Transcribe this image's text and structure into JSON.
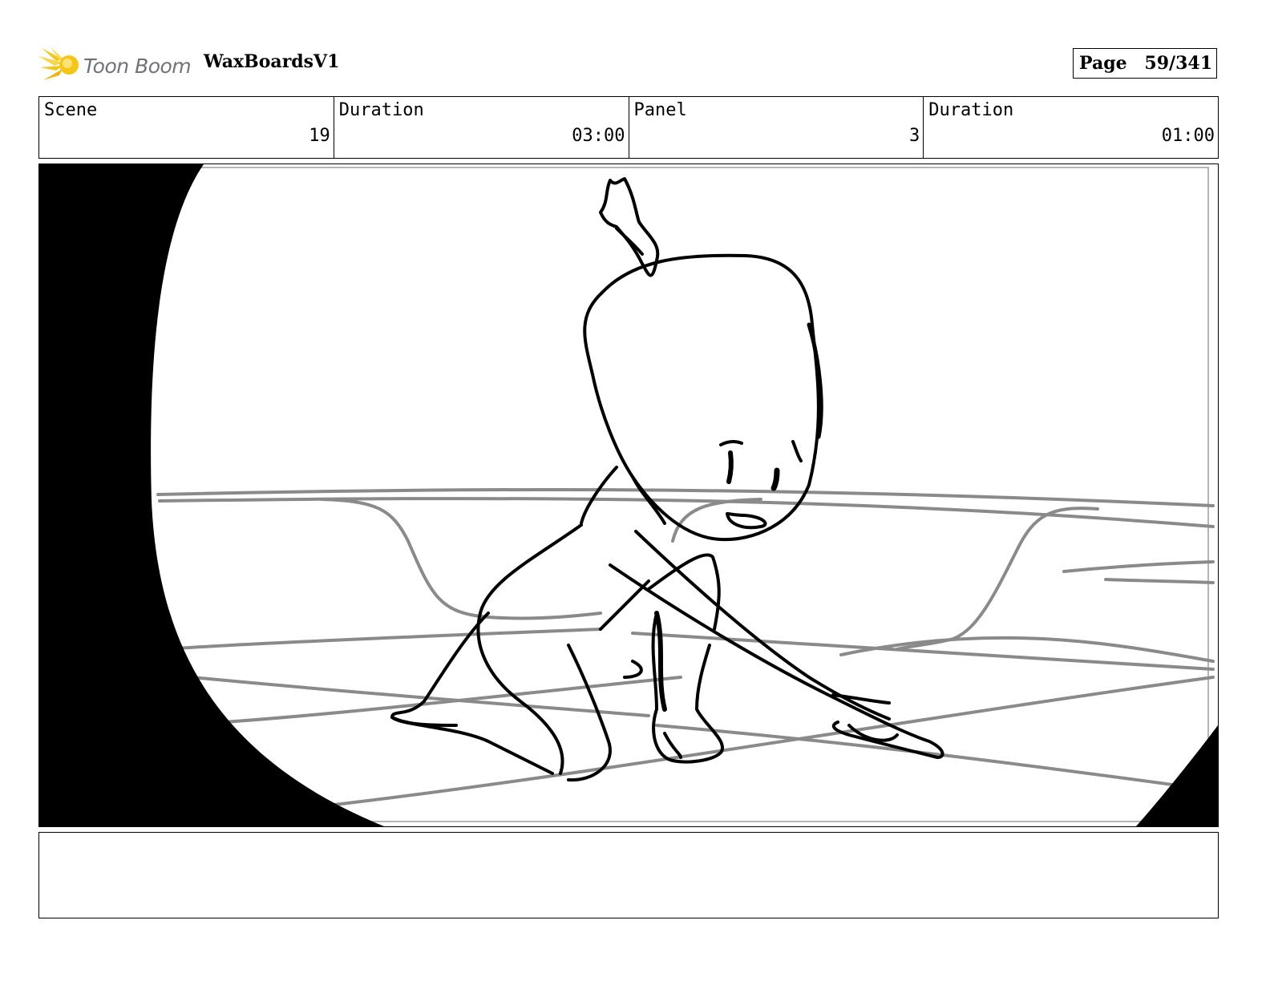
{
  "header": {
    "logo_text": "Toon Boom",
    "project_title": "WaxBoardsV1",
    "page_label": "Page",
    "page_value": "59/341"
  },
  "info": {
    "scene_label": "Scene",
    "scene_value": "19",
    "scene_duration_label": "Duration",
    "scene_duration_value": "03:00",
    "panel_label": "Panel",
    "panel_value": "3",
    "panel_duration_label": "Duration",
    "panel_duration_value": "01:00"
  },
  "colors": {
    "logo_yellow": "#f5c518",
    "logo_text": "#6f7378",
    "sketch_line": "#000000",
    "background_line": "#8a8a8a"
  },
  "icons": {
    "logo": "toon-boom-star-logo"
  }
}
